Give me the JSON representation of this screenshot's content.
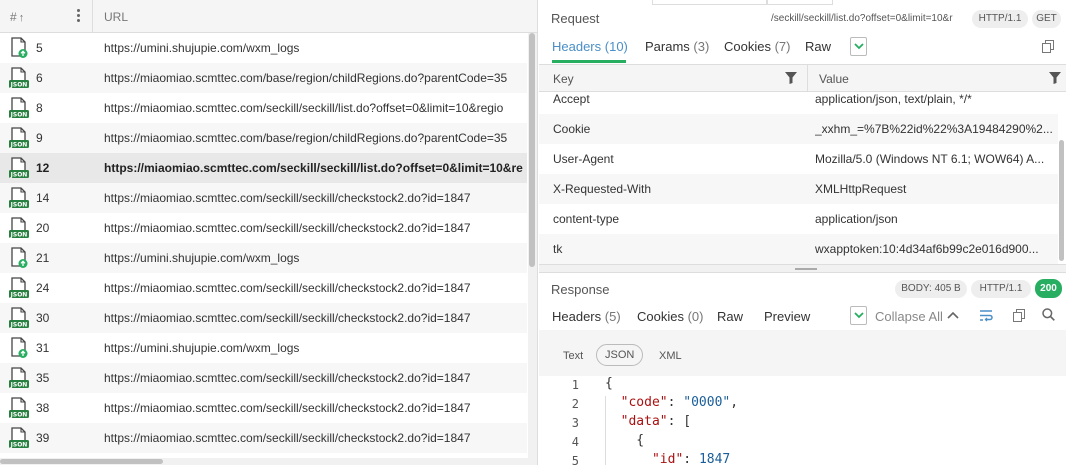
{
  "left": {
    "col_num": "#",
    "col_url": "URL",
    "rows": [
      {
        "num": "5",
        "url": "https://umini.shujupie.com/wxm_logs",
        "icon": "upload-doc-icon"
      },
      {
        "num": "6",
        "url": "https://miaomiao.scmttec.com/base/region/childRegions.do?parentCode=35",
        "icon": "json-doc-icon"
      },
      {
        "num": "8",
        "url": "https://miaomiao.scmttec.com/seckill/seckill/list.do?offset=0&limit=10&regio",
        "icon": "json-doc-icon"
      },
      {
        "num": "9",
        "url": "https://miaomiao.scmttec.com/base/region/childRegions.do?parentCode=35",
        "icon": "json-doc-icon"
      },
      {
        "num": "12",
        "url": "https://miaomiao.scmttec.com/seckill/seckill/list.do?offset=0&limit=10&re",
        "icon": "json-doc-icon",
        "selected": true
      },
      {
        "num": "14",
        "url": "https://miaomiao.scmttec.com/seckill/seckill/checkstock2.do?id=1847",
        "icon": "json-doc-icon"
      },
      {
        "num": "20",
        "url": "https://miaomiao.scmttec.com/seckill/seckill/checkstock2.do?id=1847",
        "icon": "json-doc-icon"
      },
      {
        "num": "21",
        "url": "https://umini.shujupie.com/wxm_logs",
        "icon": "upload-doc-icon"
      },
      {
        "num": "24",
        "url": "https://miaomiao.scmttec.com/seckill/seckill/checkstock2.do?id=1847",
        "icon": "json-doc-icon"
      },
      {
        "num": "30",
        "url": "https://miaomiao.scmttec.com/seckill/seckill/checkstock2.do?id=1847",
        "icon": "json-doc-icon"
      },
      {
        "num": "31",
        "url": "https://umini.shujupie.com/wxm_logs",
        "icon": "upload-doc-icon"
      },
      {
        "num": "35",
        "url": "https://miaomiao.scmttec.com/seckill/seckill/checkstock2.do?id=1847",
        "icon": "json-doc-icon"
      },
      {
        "num": "38",
        "url": "https://miaomiao.scmttec.com/seckill/seckill/checkstock2.do?id=1847",
        "icon": "json-doc-icon"
      },
      {
        "num": "39",
        "url": "https://miaomiao.scmttec.com/seckill/seckill/checkstock2.do?id=1847",
        "icon": "json-doc-icon"
      }
    ]
  },
  "request": {
    "title": "Request",
    "path": "/seckill/seckill/list.do?offset=0&limit=10&r",
    "protocol": "HTTP/1.1",
    "method": "GET",
    "tabs": {
      "headers": "Headers",
      "headers_count": "(10)",
      "params": "Params",
      "params_count": "(3)",
      "cookies": "Cookies",
      "cookies_count": "(7)",
      "raw": "Raw"
    },
    "col_key": "Key",
    "col_value": "Value",
    "headers": [
      {
        "key": "Accept",
        "value": "application/json, text/plain, */*"
      },
      {
        "key": "Cookie",
        "value": "_xxhm_=%7B%22id%22%3A19484290%2..."
      },
      {
        "key": "User-Agent",
        "value": "Mozilla/5.0 (Windows NT 6.1; WOW64) A..."
      },
      {
        "key": "X-Requested-With",
        "value": "XMLHttpRequest"
      },
      {
        "key": "content-type",
        "value": "application/json"
      },
      {
        "key": "tk",
        "value": "wxapptoken:10:4d34af6b99c2e016d900..."
      }
    ]
  },
  "response": {
    "title": "Response",
    "body_size": "BODY: 405 B",
    "protocol": "HTTP/1.1",
    "status": "200",
    "status_color": "#27ae60",
    "tabs": {
      "headers": "Headers",
      "headers_count": "(5)",
      "cookies": "Cookies",
      "cookies_count": "(0)",
      "raw": "Raw",
      "preview": "Preview"
    },
    "collapse_all": "Collapse All",
    "formats": {
      "text": "Text",
      "json": "JSON",
      "xml": "XML"
    },
    "code_lines": [
      {
        "ln": "1",
        "text": "{"
      },
      {
        "ln": "2",
        "key": "\"code\"",
        "val": "\"0000\"",
        "tail": ","
      },
      {
        "ln": "3",
        "key": "\"data\"",
        "val": "",
        "tail": "["
      },
      {
        "ln": "4",
        "text": "    {"
      },
      {
        "ln": "5",
        "key": "\"id\"",
        "val": "1847",
        "tail": ""
      }
    ]
  }
}
